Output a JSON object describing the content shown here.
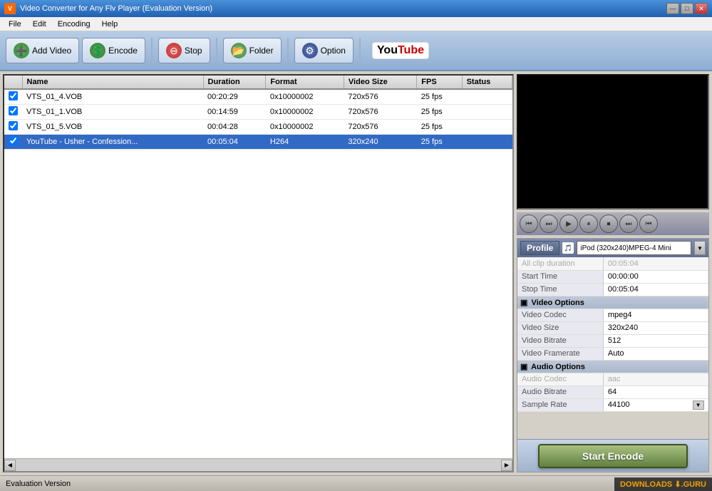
{
  "window": {
    "title": "Video Converter for Any Flv Player (Evaluation Version)",
    "icon": "V"
  },
  "titlebar_controls": {
    "minimize": "—",
    "maximize": "□",
    "close": "✕"
  },
  "menu": {
    "items": [
      "File",
      "Edit",
      "Encoding",
      "Help"
    ]
  },
  "toolbar": {
    "add_video_label": "Add Video",
    "encode_label": "Encode",
    "stop_label": "Stop",
    "folder_label": "Folder",
    "option_label": "Option",
    "youtube_label": "You",
    "youtube_label2": "Tube"
  },
  "file_list": {
    "columns": [
      "Name",
      "Duration",
      "Format",
      "Video Size",
      "FPS",
      "Status"
    ],
    "rows": [
      {
        "checked": true,
        "name": "VTS_01_4.VOB",
        "duration": "00:20:29",
        "format": "0x10000002",
        "video_size": "720x576",
        "fps": "25 fps",
        "status": "",
        "selected": false
      },
      {
        "checked": true,
        "name": "VTS_01_1.VOB",
        "duration": "00:14:59",
        "format": "0x10000002",
        "video_size": "720x576",
        "fps": "25 fps",
        "status": "",
        "selected": false
      },
      {
        "checked": true,
        "name": "VTS_01_5.VOB",
        "duration": "00:04:28",
        "format": "0x10000002",
        "video_size": "720x576",
        "fps": "25 fps",
        "status": "",
        "selected": false
      },
      {
        "checked": true,
        "name": "YouTube - Usher - Confession...",
        "duration": "00:05:04",
        "format": "H264",
        "video_size": "320x240",
        "fps": "25 fps",
        "status": "",
        "selected": true
      }
    ]
  },
  "playback": {
    "buttons": [
      "⏮",
      "⏭",
      "▶",
      "⏸",
      "⏹",
      "⏭",
      "⏮"
    ]
  },
  "profile": {
    "label": "Profile",
    "selected": "iPod (320x240)MPEG-4 Mini",
    "properties": {
      "all_clip_duration_label": "All clip duration",
      "all_clip_duration_value": "00:05:04",
      "start_time_label": "Start Time",
      "start_time_value": "00:00:00",
      "stop_time_label": "Stop Time",
      "stop_time_value": "00:05:04"
    },
    "video_options": {
      "section_label": "Video Options",
      "codec_label": "Video Codec",
      "codec_value": "mpeg4",
      "size_label": "Video Size",
      "size_value": "320x240",
      "bitrate_label": "Video Bitrate",
      "bitrate_value": "512",
      "framerate_label": "Video Framerate",
      "framerate_value": "Auto"
    },
    "audio_options": {
      "section_label": "Audio Options",
      "codec_label": "Audio Codec",
      "codec_value": "aac",
      "bitrate_label": "Audio Bitrate",
      "bitrate_value": "64",
      "sample_rate_label": "Sample Rate",
      "sample_rate_value": "44100"
    }
  },
  "encode_btn": {
    "label": "Start Encode"
  },
  "status_bar": {
    "text": "Evaluation Version"
  },
  "watermark": {
    "text": "DOWNLOADS",
    "icon": "⬇",
    "suffix": ".GURU"
  },
  "icons": {
    "add": "+",
    "encode": "$",
    "stop": "−",
    "folder": "📁",
    "option": "⚙",
    "rewind": "⏮",
    "forward_rewind": "⏭",
    "play": "▶",
    "pause": "⏸",
    "stop_ctrl": "⏹",
    "skip_forward": "⏭",
    "skip_back": "⏮",
    "collapse": "▣",
    "dropdown": "▼",
    "scroll_left": "◀",
    "scroll_right": "▶"
  }
}
